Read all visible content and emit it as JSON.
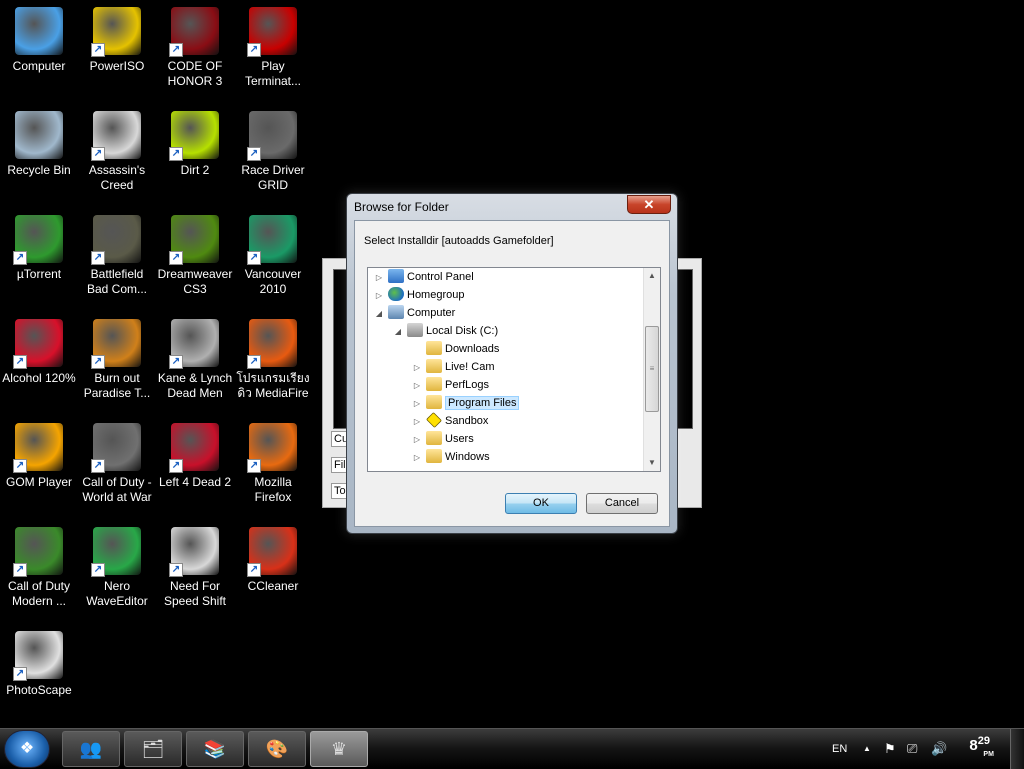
{
  "desktop": {
    "icons": [
      {
        "label": "Computer",
        "icon": "computer-icon",
        "color": "#4aa0e6",
        "shortcut": false
      },
      {
        "label": "PowerISO",
        "icon": "poweriso-icon",
        "color": "#e5c200",
        "shortcut": true
      },
      {
        "label": "CODE OF HONOR 3",
        "icon": "code-of-honor-icon",
        "color": "#8a0d14",
        "shortcut": true
      },
      {
        "label": "Play Terminat...",
        "icon": "terminator-icon",
        "color": "#c80000",
        "shortcut": true
      },
      {
        "label": "Recycle Bin",
        "icon": "recycle-bin-icon",
        "color": "#a0b8cc",
        "shortcut": false
      },
      {
        "label": "Assassin's Creed",
        "icon": "assassins-creed-icon",
        "color": "#d8d8d8",
        "shortcut": true
      },
      {
        "label": "Dirt 2",
        "icon": "dirt2-icon",
        "color": "#b6e000",
        "shortcut": true
      },
      {
        "label": "Race Driver GRID",
        "icon": "grid-icon",
        "color": "#6a6a6a",
        "shortcut": true
      },
      {
        "label": "µTorrent",
        "icon": "utorrent-icon",
        "color": "#2e9a2e",
        "shortcut": true
      },
      {
        "label": "Battlefield Bad Com...",
        "icon": "battlefield-icon",
        "color": "#5a5a48",
        "shortcut": true
      },
      {
        "label": "Dreamweaver CS3",
        "icon": "dreamweaver-icon",
        "color": "#4f8a10",
        "shortcut": true
      },
      {
        "label": "Vancouver 2010",
        "icon": "vancouver-icon",
        "color": "#1a9a66",
        "shortcut": true
      },
      {
        "label": "Alcohol 120%",
        "icon": "alcohol-icon",
        "color": "#d8102a",
        "shortcut": true
      },
      {
        "label": "Burn out Paradise T...",
        "icon": "burnout-icon",
        "color": "#d0801a",
        "shortcut": true
      },
      {
        "label": "Kane & Lynch Dead Men",
        "icon": "kane-lynch-icon",
        "color": "#b0b0b0",
        "shortcut": true
      },
      {
        "label": "โปรแกรมเรียงดิว MediaFire",
        "icon": "mediafire-icon",
        "color": "#e85a10",
        "shortcut": true
      },
      {
        "label": "GOM Player",
        "icon": "gom-player-icon",
        "color": "#f5a400",
        "shortcut": true
      },
      {
        "label": "Call of Duty - World at War",
        "icon": "cod-waw-icon",
        "color": "#707070",
        "shortcut": true
      },
      {
        "label": "Left 4 Dead 2",
        "icon": "left4dead-icon",
        "color": "#c8102a",
        "shortcut": true
      },
      {
        "label": "Mozilla Firefox",
        "icon": "firefox-icon",
        "color": "#e86a10",
        "shortcut": true
      },
      {
        "label": "Call of Duty Modern ...",
        "icon": "cod-mw-icon",
        "color": "#3a8a2a",
        "shortcut": true
      },
      {
        "label": "Nero WaveEditor",
        "icon": "nero-icon",
        "color": "#28a848",
        "shortcut": true
      },
      {
        "label": "Need For Speed Shift",
        "icon": "nfs-shift-icon",
        "color": "#d8d8d8",
        "shortcut": true
      },
      {
        "label": "CCleaner",
        "icon": "ccleaner-icon",
        "color": "#d83018",
        "shortcut": true
      },
      {
        "label": "PhotoScape",
        "icon": "photoscape-icon",
        "color": "#e0e0e0",
        "shortcut": true
      }
    ]
  },
  "ghost_window": {
    "fields": [
      "Cu",
      "File",
      "To"
    ]
  },
  "dialog": {
    "title": "Browse for Folder",
    "close_glyph": "✕",
    "prompt": "Select Installdir [autoadds Gamefolder]",
    "tree": [
      {
        "label": "Control Panel",
        "icon": "control-panel-icon",
        "cls": "cp",
        "expander": "▷",
        "indent": 0
      },
      {
        "label": "Homegroup",
        "icon": "homegroup-icon",
        "cls": "hg",
        "expander": "▷",
        "indent": 0
      },
      {
        "label": "Computer",
        "icon": "computer-icon",
        "cls": "pc",
        "expander": "◢",
        "indent": 0
      },
      {
        "label": "Local Disk (C:)",
        "icon": "drive-icon",
        "cls": "disk",
        "expander": "◢",
        "indent": 1
      },
      {
        "label": "Downloads",
        "icon": "folder-icon",
        "cls": "fold",
        "expander": "",
        "indent": 2
      },
      {
        "label": "Live! Cam",
        "icon": "folder-icon",
        "cls": "fold",
        "expander": "▷",
        "indent": 2
      },
      {
        "label": "PerfLogs",
        "icon": "folder-icon",
        "cls": "fold",
        "expander": "▷",
        "indent": 2
      },
      {
        "label": "Program Files",
        "icon": "folder-icon",
        "cls": "fold",
        "expander": "▷",
        "indent": 2,
        "selected": true
      },
      {
        "label": "Sandbox",
        "icon": "sandbox-icon",
        "cls": "sand",
        "expander": "▷",
        "indent": 2
      },
      {
        "label": "Users",
        "icon": "folder-icon",
        "cls": "fold",
        "expander": "▷",
        "indent": 2
      },
      {
        "label": "Windows",
        "icon": "folder-icon",
        "cls": "fold",
        "expander": "▷",
        "indent": 2
      }
    ],
    "ok_label": "OK",
    "cancel_label": "Cancel"
  },
  "taskbar": {
    "start_glyph": "❖",
    "buttons": [
      {
        "name": "messenger-icon",
        "glyph": "👥",
        "active": false
      },
      {
        "name": "explorer-icon",
        "glyph": "🗂",
        "active": false
      },
      {
        "name": "winrar-icon",
        "glyph": "📚",
        "active": false
      },
      {
        "name": "paint-icon",
        "glyph": "🎨",
        "active": false
      },
      {
        "name": "game-crown-icon",
        "glyph": "♛",
        "active": true
      }
    ],
    "language": "EN",
    "tray_up_glyph": "▲",
    "tray_icons": [
      "⚑",
      "⎚",
      "🔊"
    ],
    "clock_hour": "8",
    "clock_minute": "29",
    "clock_ampm": "PM"
  }
}
